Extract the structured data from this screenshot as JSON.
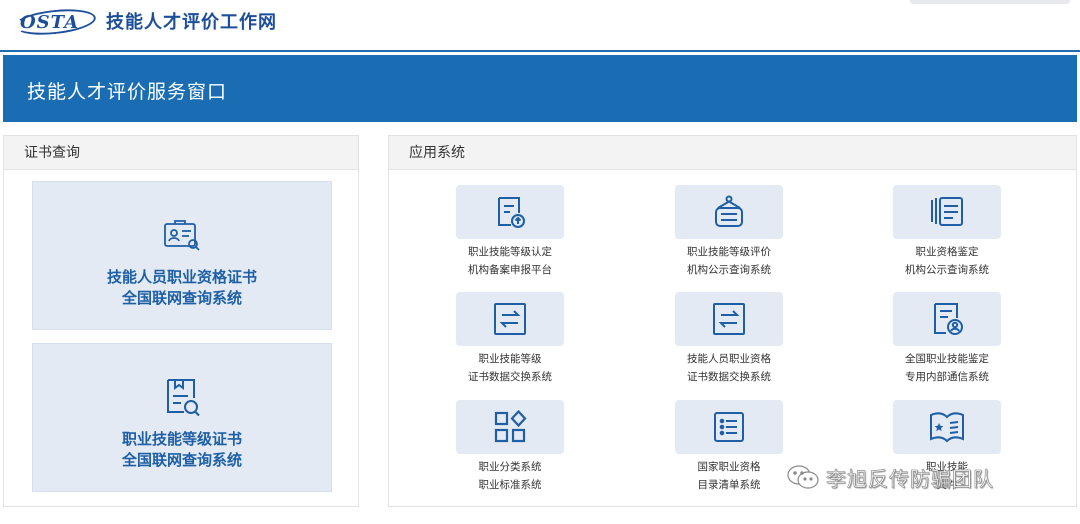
{
  "header": {
    "logo_text": "OSTA",
    "site_title": "技能人才评价工作网"
  },
  "banner": {
    "title": "技能人才评价服务窗口"
  },
  "cert_query": {
    "heading": "证书查询",
    "cards": [
      {
        "line1": "技能人员职业资格证书",
        "line2": "全国联网查询系统",
        "icon": "certificate-search-icon"
      },
      {
        "line1": "职业技能等级证书",
        "line2": "全国联网查询系统",
        "icon": "document-search-icon"
      }
    ]
  },
  "apps": {
    "heading": "应用系统",
    "items": [
      {
        "line1": "职业技能等级认定",
        "line2": "机构备案申报平台",
        "icon": "document-upload-icon"
      },
      {
        "line1": "职业技能等级评价",
        "line2": "机构公示查询系统",
        "icon": "bulletin-board-icon"
      },
      {
        "line1": "职业资格鉴定",
        "line2": "机构公示查询系统",
        "icon": "stacked-documents-icon"
      },
      {
        "line1": "职业技能等级",
        "line2": "证书数据交换系统",
        "icon": "exchange-icon"
      },
      {
        "line1": "技能人员职业资格",
        "line2": "证书数据交换系统",
        "icon": "exchange-icon"
      },
      {
        "line1": "全国职业技能鉴定",
        "line2": "专用内部通信系统",
        "icon": "user-document-icon"
      },
      {
        "line1": "职业分类系统",
        "line2": "职业标准系统",
        "icon": "category-grid-icon"
      },
      {
        "line1": "国家职业资格",
        "line2": "目录清单系统",
        "icon": "list-icon"
      },
      {
        "line1": "职业技能",
        "line2": "文件",
        "icon": "book-star-icon"
      }
    ]
  },
  "watermark": {
    "text": "李旭反传防骗团队",
    "icon": "wechat-icon"
  },
  "colors": {
    "brand_blue": "#1b6db3",
    "accent_blue": "#1e5fa6",
    "tile_bg": "#e3eaf4"
  }
}
